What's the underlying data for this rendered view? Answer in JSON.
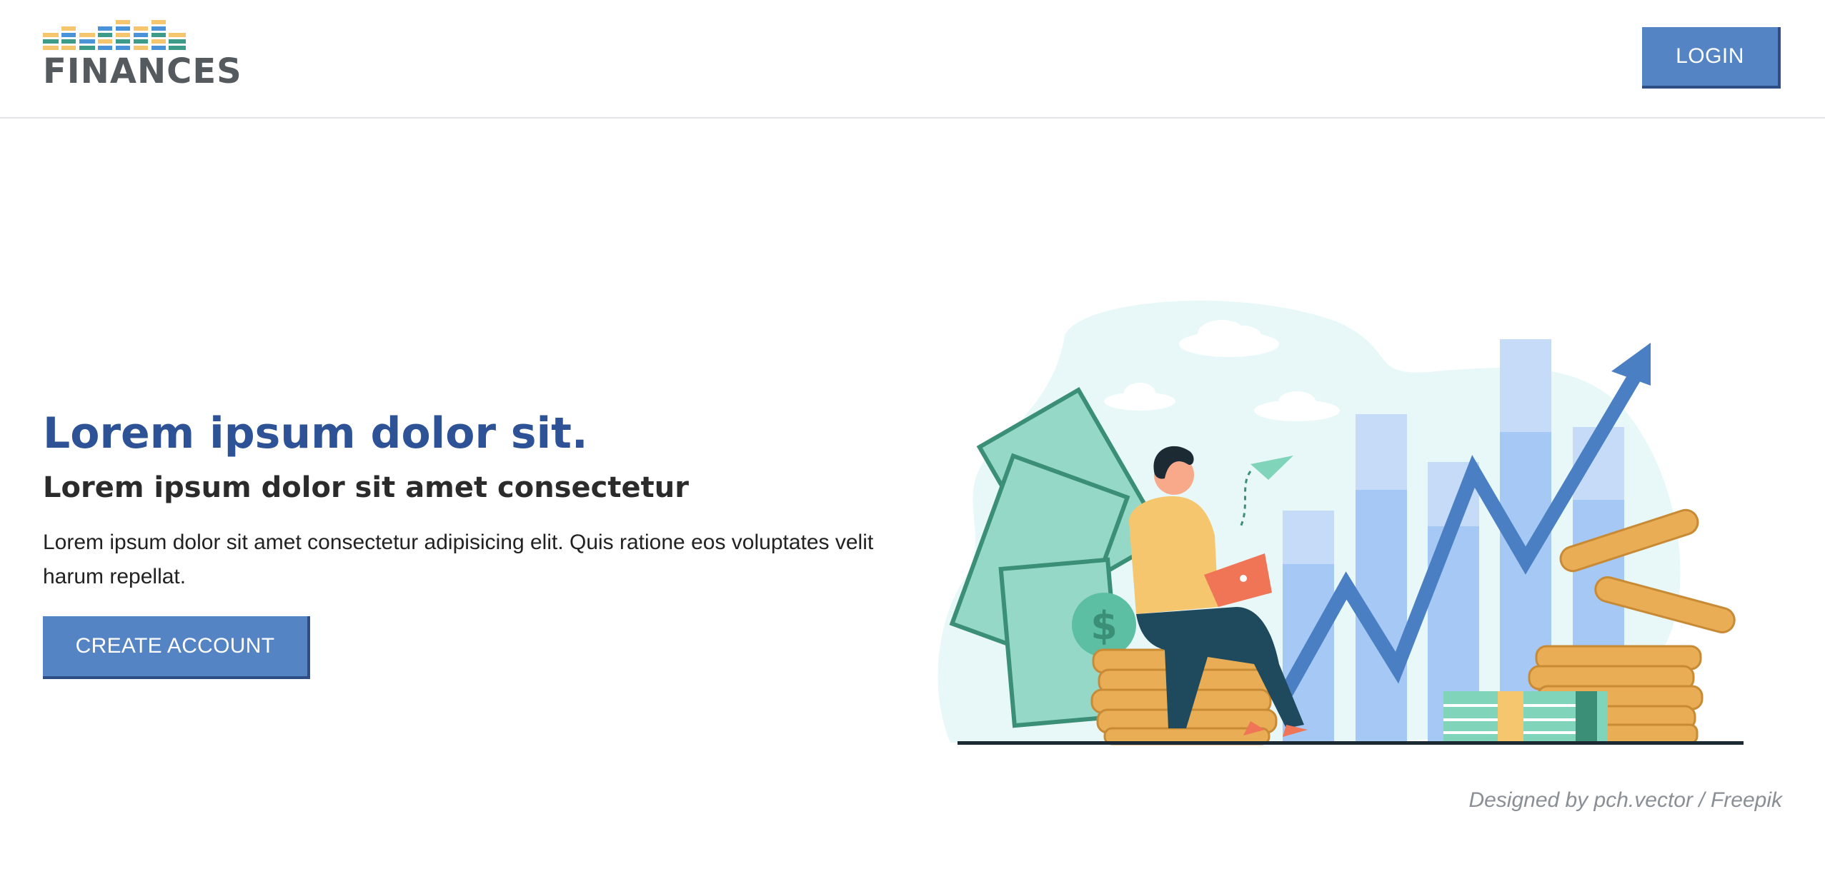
{
  "header": {
    "logo_text": "FINANCES",
    "login_label": "LOGIN"
  },
  "hero": {
    "title": "Lorem ipsum dolor sit.",
    "subtitle": "Lorem ipsum dolor sit amet consectetur",
    "body": "Lorem ipsum dolor sit amet consectetur adipisicing elit. Quis ratione eos voluptates velit harum repellat.",
    "cta_label": "CREATE ACCOUNT"
  },
  "footer": {
    "credit": "Designed by pch.vector / Freepik"
  },
  "colors": {
    "primary": "#5584c4",
    "primary_dark": "#2d4e84",
    "title_blue": "#2e5296",
    "logo_gray": "#555a5f",
    "logo_yellow": "#f5c66e",
    "logo_blue": "#4a93d8",
    "logo_green": "#3d9b8a"
  },
  "icons": {
    "logo": "finances-bars-logo",
    "illustration": "person-laptop-growth-chart"
  }
}
